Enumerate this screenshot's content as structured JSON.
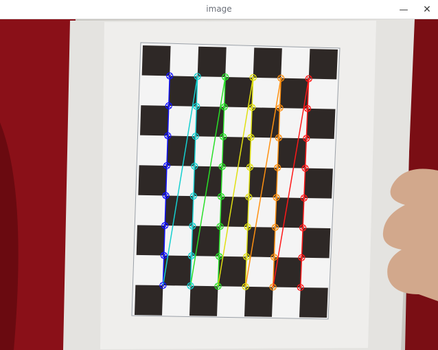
{
  "window": {
    "title": "image",
    "minimize_symbol": "—",
    "close_symbol": "✕"
  },
  "corner_colors": [
    "#1010ff",
    "#14d0d0",
    "#28e028",
    "#e0e010",
    "#ff9010",
    "#ff1818"
  ],
  "board_colors": {
    "dark": "#2e2826",
    "light": "#f4f4f4",
    "paper": "#e9e8e6",
    "background": "#8a1018"
  }
}
